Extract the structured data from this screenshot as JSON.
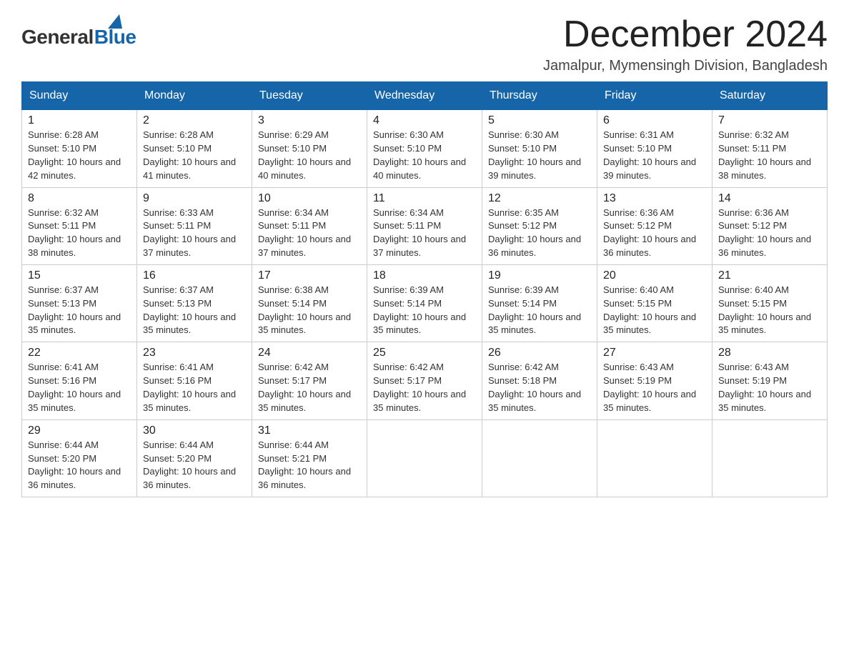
{
  "logo": {
    "general_text": "General",
    "blue_text": "Blue"
  },
  "title": "December 2024",
  "subtitle": "Jamalpur, Mymensingh Division, Bangladesh",
  "days_of_week": [
    "Sunday",
    "Monday",
    "Tuesday",
    "Wednesday",
    "Thursday",
    "Friday",
    "Saturday"
  ],
  "weeks": [
    [
      {
        "day": "1",
        "sunrise": "6:28 AM",
        "sunset": "5:10 PM",
        "daylight": "10 hours and 42 minutes."
      },
      {
        "day": "2",
        "sunrise": "6:28 AM",
        "sunset": "5:10 PM",
        "daylight": "10 hours and 41 minutes."
      },
      {
        "day": "3",
        "sunrise": "6:29 AM",
        "sunset": "5:10 PM",
        "daylight": "10 hours and 40 minutes."
      },
      {
        "day": "4",
        "sunrise": "6:30 AM",
        "sunset": "5:10 PM",
        "daylight": "10 hours and 40 minutes."
      },
      {
        "day": "5",
        "sunrise": "6:30 AM",
        "sunset": "5:10 PM",
        "daylight": "10 hours and 39 minutes."
      },
      {
        "day": "6",
        "sunrise": "6:31 AM",
        "sunset": "5:10 PM",
        "daylight": "10 hours and 39 minutes."
      },
      {
        "day": "7",
        "sunrise": "6:32 AM",
        "sunset": "5:11 PM",
        "daylight": "10 hours and 38 minutes."
      }
    ],
    [
      {
        "day": "8",
        "sunrise": "6:32 AM",
        "sunset": "5:11 PM",
        "daylight": "10 hours and 38 minutes."
      },
      {
        "day": "9",
        "sunrise": "6:33 AM",
        "sunset": "5:11 PM",
        "daylight": "10 hours and 37 minutes."
      },
      {
        "day": "10",
        "sunrise": "6:34 AM",
        "sunset": "5:11 PM",
        "daylight": "10 hours and 37 minutes."
      },
      {
        "day": "11",
        "sunrise": "6:34 AM",
        "sunset": "5:11 PM",
        "daylight": "10 hours and 37 minutes."
      },
      {
        "day": "12",
        "sunrise": "6:35 AM",
        "sunset": "5:12 PM",
        "daylight": "10 hours and 36 minutes."
      },
      {
        "day": "13",
        "sunrise": "6:36 AM",
        "sunset": "5:12 PM",
        "daylight": "10 hours and 36 minutes."
      },
      {
        "day": "14",
        "sunrise": "6:36 AM",
        "sunset": "5:12 PM",
        "daylight": "10 hours and 36 minutes."
      }
    ],
    [
      {
        "day": "15",
        "sunrise": "6:37 AM",
        "sunset": "5:13 PM",
        "daylight": "10 hours and 35 minutes."
      },
      {
        "day": "16",
        "sunrise": "6:37 AM",
        "sunset": "5:13 PM",
        "daylight": "10 hours and 35 minutes."
      },
      {
        "day": "17",
        "sunrise": "6:38 AM",
        "sunset": "5:14 PM",
        "daylight": "10 hours and 35 minutes."
      },
      {
        "day": "18",
        "sunrise": "6:39 AM",
        "sunset": "5:14 PM",
        "daylight": "10 hours and 35 minutes."
      },
      {
        "day": "19",
        "sunrise": "6:39 AM",
        "sunset": "5:14 PM",
        "daylight": "10 hours and 35 minutes."
      },
      {
        "day": "20",
        "sunrise": "6:40 AM",
        "sunset": "5:15 PM",
        "daylight": "10 hours and 35 minutes."
      },
      {
        "day": "21",
        "sunrise": "6:40 AM",
        "sunset": "5:15 PM",
        "daylight": "10 hours and 35 minutes."
      }
    ],
    [
      {
        "day": "22",
        "sunrise": "6:41 AM",
        "sunset": "5:16 PM",
        "daylight": "10 hours and 35 minutes."
      },
      {
        "day": "23",
        "sunrise": "6:41 AM",
        "sunset": "5:16 PM",
        "daylight": "10 hours and 35 minutes."
      },
      {
        "day": "24",
        "sunrise": "6:42 AM",
        "sunset": "5:17 PM",
        "daylight": "10 hours and 35 minutes."
      },
      {
        "day": "25",
        "sunrise": "6:42 AM",
        "sunset": "5:17 PM",
        "daylight": "10 hours and 35 minutes."
      },
      {
        "day": "26",
        "sunrise": "6:42 AM",
        "sunset": "5:18 PM",
        "daylight": "10 hours and 35 minutes."
      },
      {
        "day": "27",
        "sunrise": "6:43 AM",
        "sunset": "5:19 PM",
        "daylight": "10 hours and 35 minutes."
      },
      {
        "day": "28",
        "sunrise": "6:43 AM",
        "sunset": "5:19 PM",
        "daylight": "10 hours and 35 minutes."
      }
    ],
    [
      {
        "day": "29",
        "sunrise": "6:44 AM",
        "sunset": "5:20 PM",
        "daylight": "10 hours and 36 minutes."
      },
      {
        "day": "30",
        "sunrise": "6:44 AM",
        "sunset": "5:20 PM",
        "daylight": "10 hours and 36 minutes."
      },
      {
        "day": "31",
        "sunrise": "6:44 AM",
        "sunset": "5:21 PM",
        "daylight": "10 hours and 36 minutes."
      },
      null,
      null,
      null,
      null
    ]
  ]
}
